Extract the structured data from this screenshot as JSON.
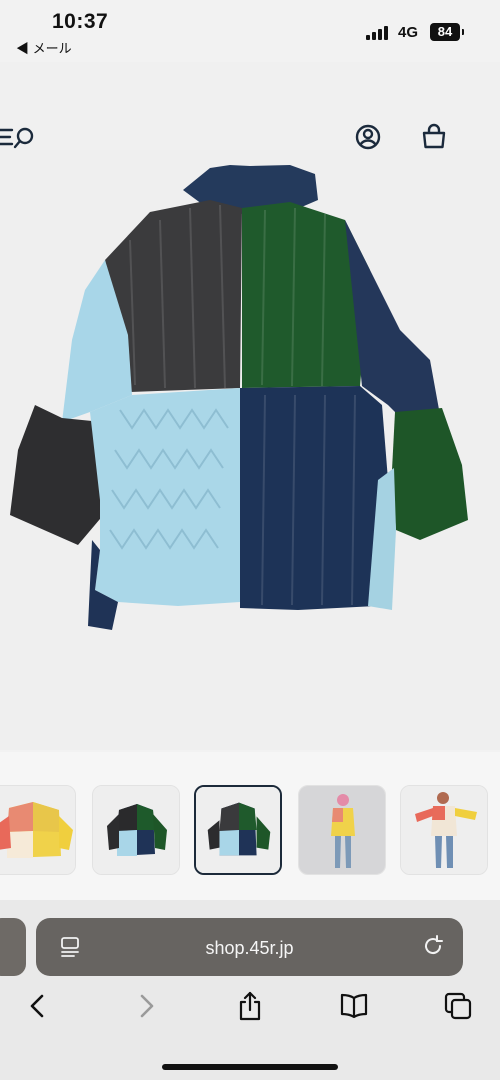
{
  "status_bar": {
    "time": "10:37",
    "back_app": "◀ メール",
    "network": "4G",
    "battery": "84"
  },
  "header": {
    "icons": [
      "menu-icon",
      "search-icon",
      "account-icon",
      "cart-icon"
    ]
  },
  "product": {
    "colors": {
      "charcoal": "#3a3a3a",
      "green": "#1f5a2a",
      "navy": "#20375a",
      "lightblue": "#a9d6e6"
    }
  },
  "thumbnails": {
    "count": 5,
    "active_index": 2
  },
  "browser": {
    "url": "shop.45r.jp",
    "toolbar": [
      "back-icon",
      "forward-icon",
      "share-icon",
      "bookmarks-icon",
      "tabs-icon"
    ]
  }
}
